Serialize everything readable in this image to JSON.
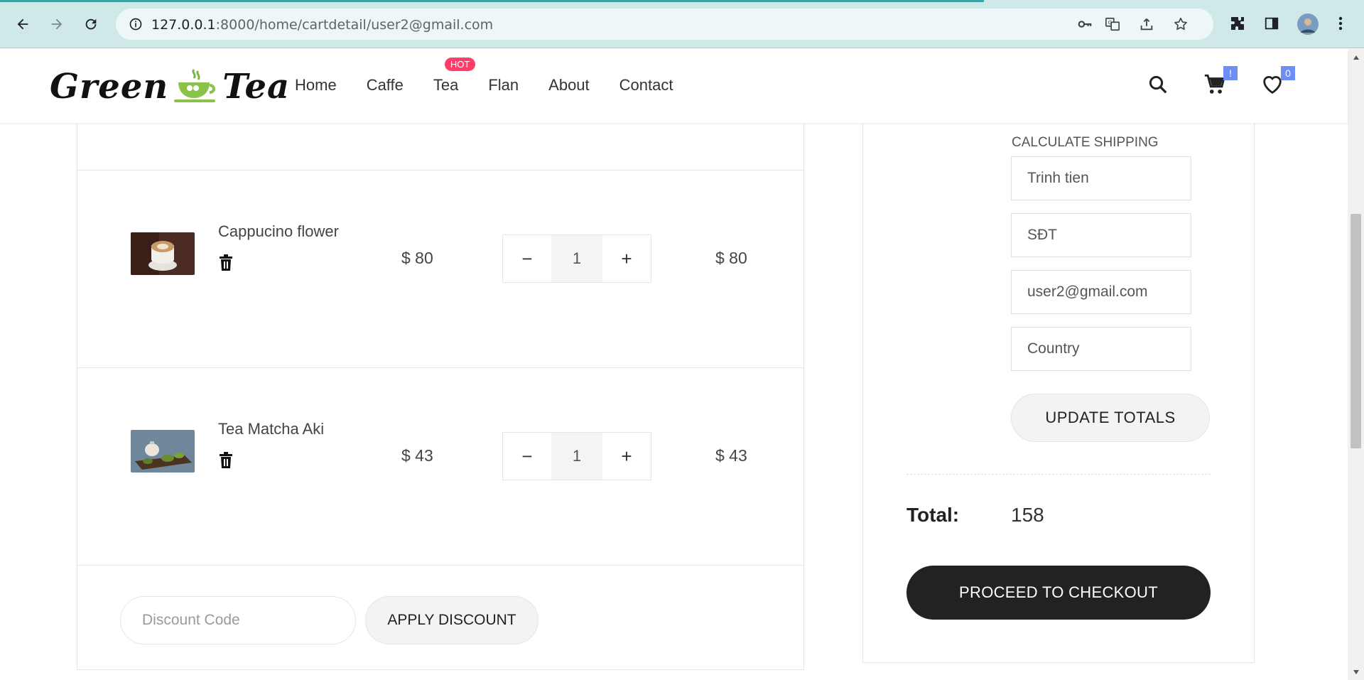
{
  "browser": {
    "url_host": "127.0.0.1",
    "url_rest": ":8000/home/cartdetail/user2@gmail.com"
  },
  "header": {
    "logo_left": "Green",
    "logo_right": "Tea",
    "menu": [
      {
        "label": "Home"
      },
      {
        "label": "Caffe"
      },
      {
        "label": "Tea",
        "badge": "HOT"
      },
      {
        "label": "Flan"
      },
      {
        "label": "About"
      },
      {
        "label": "Contact"
      }
    ],
    "cart_badge": "!",
    "wishlist_badge": "0"
  },
  "cart": {
    "items": [
      {
        "name": "Cappucino flower",
        "price": "$ 80",
        "quantity": "1",
        "subtotal": "$ 80"
      },
      {
        "name": "Tea Matcha Aki",
        "price": "$ 43",
        "quantity": "1",
        "subtotal": "$ 43"
      }
    ],
    "minus_symbol": "−",
    "plus_symbol": "+",
    "discount_placeholder": "Discount Code",
    "apply_label": "APPLY DISCOUNT"
  },
  "totals": {
    "shipping_label": "CALCULATE SHIPPING",
    "name_value": "Trinh tien",
    "phone_value": "SĐT",
    "email_value": "user2@gmail.com",
    "country_value": "Country",
    "update_label": "UPDATE TOTALS",
    "total_label": "Total:",
    "total_value": "158",
    "checkout_label": "PROCEED TO CHECKOUT"
  },
  "colors": {
    "chrome_bg": "#cfe9e9",
    "hot_badge": "#ff3d6a",
    "count_badge": "#6c8ef5",
    "checkout_bg": "#222222"
  }
}
